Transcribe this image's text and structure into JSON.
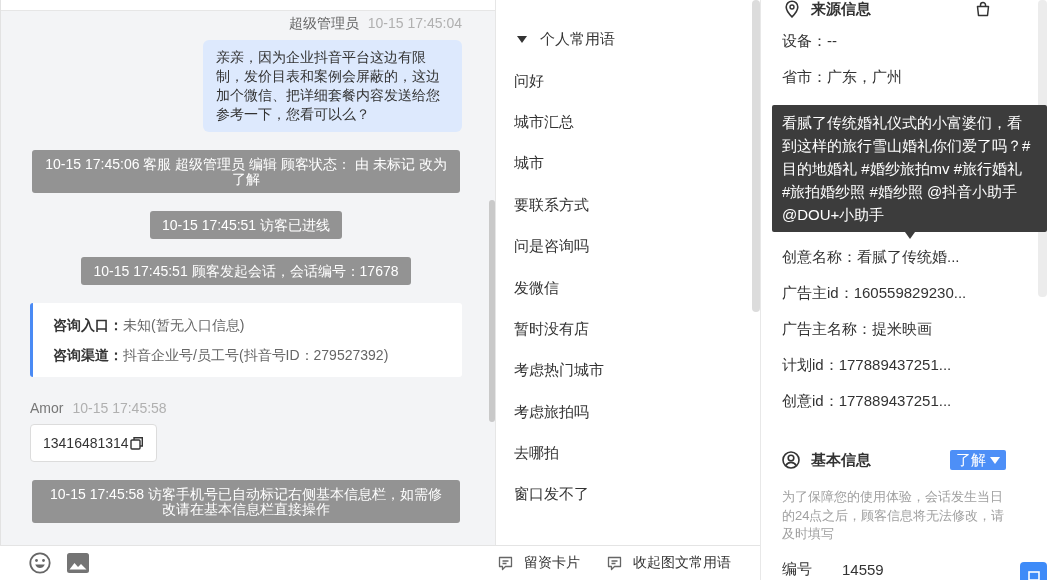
{
  "chat": {
    "messages": [
      {
        "kind": "agent",
        "sender": "超级管理员",
        "time": "10-15 17:45:04",
        "text": "亲亲，因为企业抖音平台这边有限制，发价目表和案例会屏蔽的，这边加个微信、把详细套餐内容发送给您参考一下，您看可以么？"
      },
      {
        "kind": "system",
        "text": "10-15 17:45:06 客服 超级管理员 编辑 顾客状态： 由 未标记 改为了解"
      },
      {
        "kind": "system",
        "text": "10-15 17:45:51 访客已进线"
      },
      {
        "kind": "system",
        "text": "10-15 17:45:51 顾客发起会话，会话编号：17678"
      },
      {
        "kind": "entry_card",
        "rows": [
          {
            "label": "咨询入口：",
            "value": "未知(暂无入口信息)"
          },
          {
            "label": "咨询渠道：",
            "value": "抖音企业号/员工号(抖音号ID：279527392)"
          }
        ]
      },
      {
        "kind": "visitor",
        "sender": "Amor",
        "time": "10-15 17:45:58",
        "text": "13416481314"
      },
      {
        "kind": "system",
        "text": "10-15 17:45:58 访客手机号已自动标记右侧基本信息栏，如需修改请在基本信息栏直接操作"
      }
    ]
  },
  "phrases": {
    "group": {
      "title": "个人常用语",
      "expanded": true
    },
    "items": [
      "问好",
      "城市汇总",
      "城市",
      "要联系方式",
      "问是咨询吗",
      "发微信",
      "暂时没有店",
      "考虑热门城市",
      "考虑旅拍吗",
      "去哪拍",
      "窗口发不了"
    ]
  },
  "toolbar": {
    "buttons": [
      "留资卡片",
      "收起图文常用语"
    ]
  },
  "source_info": {
    "title": "来源信息",
    "rows_above": [
      "设备：--",
      "省市：广东，广州"
    ],
    "tooltip": "看腻了传统婚礼仪式的小富婆们，看到这样的旅行雪山婚礼你们爱了吗？#目的地婚礼 #婚纱旅拍mv #旅行婚礼 #旅拍婚纱照 #婚纱照 @抖音小助手 @DOU+小助手",
    "rows_below": [
      "创意名称：看腻了传统婚...",
      "广告主id：160559829230...",
      "广告主名称：提米映画",
      "计划id：177889437251...",
      "创意id：177889437251..."
    ]
  },
  "basic_info": {
    "title": "基本信息",
    "status": "了解",
    "note": "为了保障您的使用体验，会话发生当日的24点之后，顾客信息将无法修改，请及时填写",
    "fields": [
      {
        "label": "编号",
        "value": "14559"
      }
    ]
  }
}
